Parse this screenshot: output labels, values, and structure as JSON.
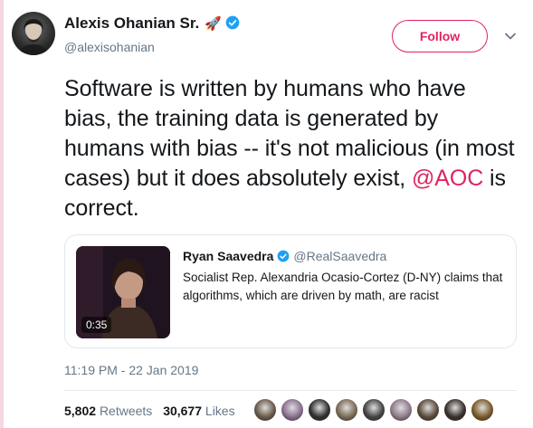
{
  "author": {
    "name": "Alexis Ohanian Sr.",
    "emoji": "🚀",
    "handle": "@alexisohanian"
  },
  "follow_label": "Follow",
  "tweet": {
    "text_before": "Software is written by humans who have bias, the training data is generated by humans with bias -- it's not malicious (in most cases) but it does absolutely exist, ",
    "mention": "@AOC",
    "text_after": " is correct."
  },
  "quote": {
    "name": "Ryan Saavedra",
    "handle": "@RealSaavedra",
    "text": "Socialist Rep. Alexandria Ocasio-Cortez (D-NY) claims that algorithms, which are driven by math, are racist",
    "duration": "0:35"
  },
  "timestamp": "11:19 PM - 22 Jan 2019",
  "stats": {
    "retweets_count": "5,802",
    "retweets_label": "Retweets",
    "likes_count": "30,677",
    "likes_label": "Likes"
  },
  "colors": {
    "accent": "#e0245e",
    "verified": "#1da1f2",
    "secondary_text": "#657786"
  },
  "likers": [
    "#6b5a4a",
    "#8a6f8f",
    "#2f2f2f",
    "#7a6b55",
    "#444",
    "#8f7a8a",
    "#5a4a3a",
    "#3a2f2a",
    "#7a5a2a"
  ]
}
